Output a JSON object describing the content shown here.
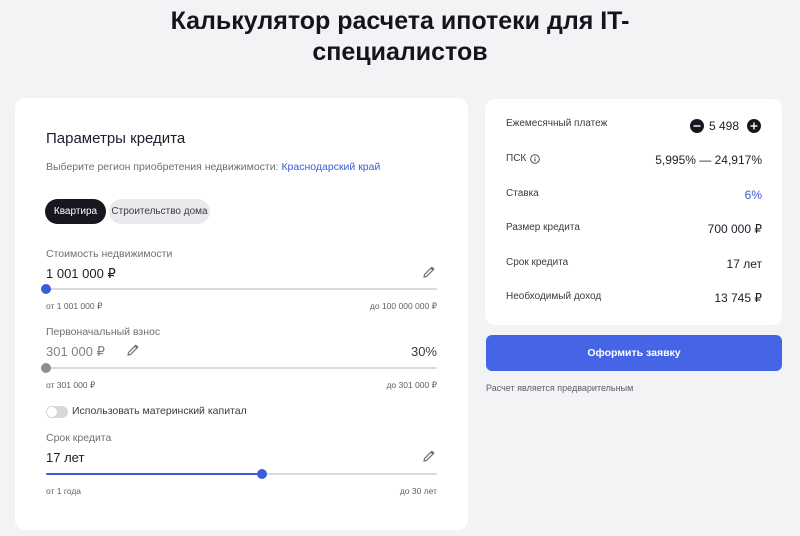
{
  "page": {
    "title_line1": "Калькулятор расчета ипотеки для IT-",
    "title_line2": "специалистов"
  },
  "params": {
    "title": "Параметры кредита",
    "region_prompt": "Выберите регион приобретения недвижимости: ",
    "region_value": "Краснодарский край",
    "tabs": [
      {
        "label": "Квартира",
        "active": true
      },
      {
        "label": "Строительство дома",
        "active": false
      }
    ],
    "property_cost": {
      "label": "Стоимость недвижимости",
      "value": "1 001 000 ₽",
      "min_label": "от 1 001 000 ₽",
      "max_label": "до 100 000 000 ₽",
      "slider_level": 0
    },
    "down_payment": {
      "label": "Первоначальный взнос",
      "value": "301 000 ₽",
      "percent": "30%",
      "min_label": "от 301 000 ₽",
      "max_label": "до 301 000 ₽",
      "slider_level": 0
    },
    "maternity_capital": {
      "label": "Использовать материнский капитал",
      "enabled": false
    },
    "term": {
      "label": "Срок кредита",
      "value": "17 лет",
      "min_label": "от 1 года",
      "max_label": "до 30 лет",
      "slider_level": 0.552
    }
  },
  "summary": {
    "monthly_payment_label": "Ежемесячный платеж",
    "monthly_payment_value": "5 498",
    "psk_label": "ПСК",
    "psk_value": "5,995% — 24,917%",
    "rate_label": "Ставка",
    "rate_value": "6%",
    "loan_amount_label": "Размер кредита",
    "loan_amount_value": "700 000 ₽",
    "loan_term_label": "Срок кредита",
    "loan_term_value": "17 лет",
    "required_income_label": "Необходимый доход",
    "required_income_value": "13 745 ₽"
  },
  "actions": {
    "apply_label": "Оформить заявку",
    "disclaimer": "Расчет является предварительным"
  },
  "colors": {
    "accent": "#3e5bd8",
    "button": "#4565e6",
    "dark": "#17171f",
    "background": "#f2f3f5"
  },
  "icons": {
    "edit": "pencil-icon",
    "minus": "minus-circle-icon",
    "plus": "plus-circle-icon",
    "info": "info-icon"
  }
}
